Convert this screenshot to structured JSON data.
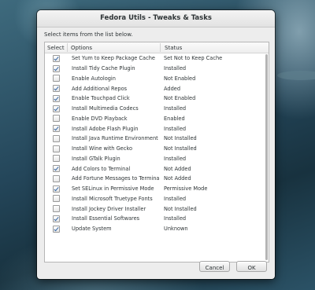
{
  "window": {
    "title": "Fedora Utils - Tweaks & Tasks",
    "instruction": "Select items from the list below."
  },
  "list": {
    "columns": {
      "select": "Select",
      "options": "Options",
      "status": "Status"
    },
    "rows": [
      {
        "checked": true,
        "option": "Set Yum to Keep Package Cache",
        "status": "Set Not to Keep Cache"
      },
      {
        "checked": true,
        "option": "Install Tidy Cache Plugin",
        "status": "Installed"
      },
      {
        "checked": false,
        "option": "Enable Autologin",
        "status": "Not Enabled"
      },
      {
        "checked": true,
        "option": "Add Additional Repos",
        "status": "Added"
      },
      {
        "checked": true,
        "option": "Enable Touchpad Click",
        "status": "Not Enabled"
      },
      {
        "checked": true,
        "option": "Install Multimedia Codecs",
        "status": "Installed"
      },
      {
        "checked": false,
        "option": "Enable DVD Playback",
        "status": "Enabled"
      },
      {
        "checked": true,
        "option": "Install Adobe Flash Plugin",
        "status": "Installed"
      },
      {
        "checked": false,
        "option": "Install Java Runtime Environment",
        "status": "Not Installed"
      },
      {
        "checked": false,
        "option": "Install Wine with Gecko",
        "status": "Not Installed"
      },
      {
        "checked": false,
        "option": "Install GTalk Plugin",
        "status": "Installed"
      },
      {
        "checked": true,
        "option": "Add Colors to Terminal",
        "status": "Not Added"
      },
      {
        "checked": false,
        "option": "Add Fortune Messages to Terminal",
        "status": "Not Added"
      },
      {
        "checked": true,
        "option": "Set SELinux in Permissive Mode",
        "status": "Permissive Mode"
      },
      {
        "checked": false,
        "option": "Install Microsoft Truetype Fonts",
        "status": "Installed"
      },
      {
        "checked": false,
        "option": "Install Jockey Driver Installer",
        "status": "Not Installed"
      },
      {
        "checked": true,
        "option": "Install Essential Softwares",
        "status": "Installed"
      },
      {
        "checked": true,
        "option": "Update System",
        "status": "Unknown"
      }
    ]
  },
  "buttons": {
    "cancel": "Cancel",
    "ok": "OK"
  },
  "colors": {
    "check_accent": "#3465a4",
    "window_bg": "#ededed"
  }
}
